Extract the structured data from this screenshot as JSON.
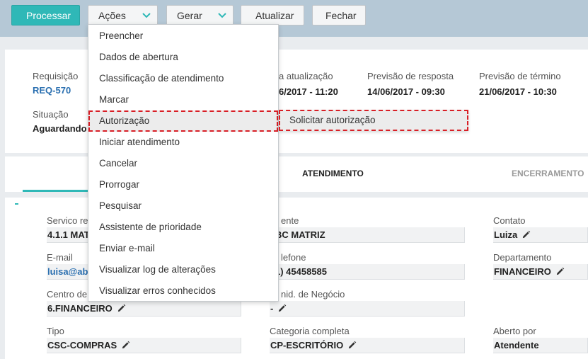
{
  "toolbar": {
    "processar": "Processar",
    "acoes": "Ações",
    "gerar": "Gerar",
    "atualizar": "Atualizar",
    "fechar": "Fechar"
  },
  "header": {
    "requisicao_label": "Requisição",
    "requisicao_value": "REQ-570",
    "ultima_label": "a atualização",
    "ultima_value": "6/2017 - 11:20",
    "prev_resposta_label": "Previsão de resposta",
    "prev_resposta_value": "14/06/2017 - 09:30",
    "prev_termino_label": "Previsão de término",
    "prev_termino_value": "21/06/2017 - 10:30",
    "situacao_label": "Situação",
    "situacao_value": "Aguardando"
  },
  "tabs": {
    "atendimento": "ATENDIMENTO",
    "encerramento": "ENCERRAMENTO"
  },
  "form": {
    "servico_label": "Servico req",
    "servico_value": "4.1.1 MAT",
    "cliente_label": "ente",
    "cliente_value": "BC MATRIZ",
    "contato_label": "Contato",
    "contato_value": "Luiza",
    "email_label": "E-mail",
    "email_value": "luisa@ab",
    "telefone_label": "lefone",
    "telefone_value": "1) 45458585",
    "departamento_label": "Departamento",
    "departamento_value": "FINANCEIRO",
    "centro_label": "Centro de C",
    "centro_value": "6.FINANCEIRO",
    "unid_label": "nid. de Negócio",
    "unid_value": "-",
    "tipo_label": "Tipo",
    "tipo_value": "CSC-COMPRAS",
    "categoria_label": "Categoria completa",
    "categoria_value": "CP-ESCRITÓRIO",
    "aberto_label": "Aberto por",
    "aberto_value": "Atendente"
  },
  "menu": {
    "items": [
      "Preencher",
      "Dados de abertura",
      "Classificação de atendimento",
      "Marcar",
      "Autorização",
      "Iniciar atendimento",
      "Cancelar",
      "Prorrogar",
      "Pesquisar",
      "Assistente de prioridade",
      "Enviar e-mail",
      "Visualizar log de alterações",
      "Visualizar erros conhecidos"
    ],
    "submenu_item": "Solicitar autorização"
  },
  "colors": {
    "accent": "#2fb8b7",
    "highlight": "#d81f26",
    "link": "#2a6fb0"
  }
}
